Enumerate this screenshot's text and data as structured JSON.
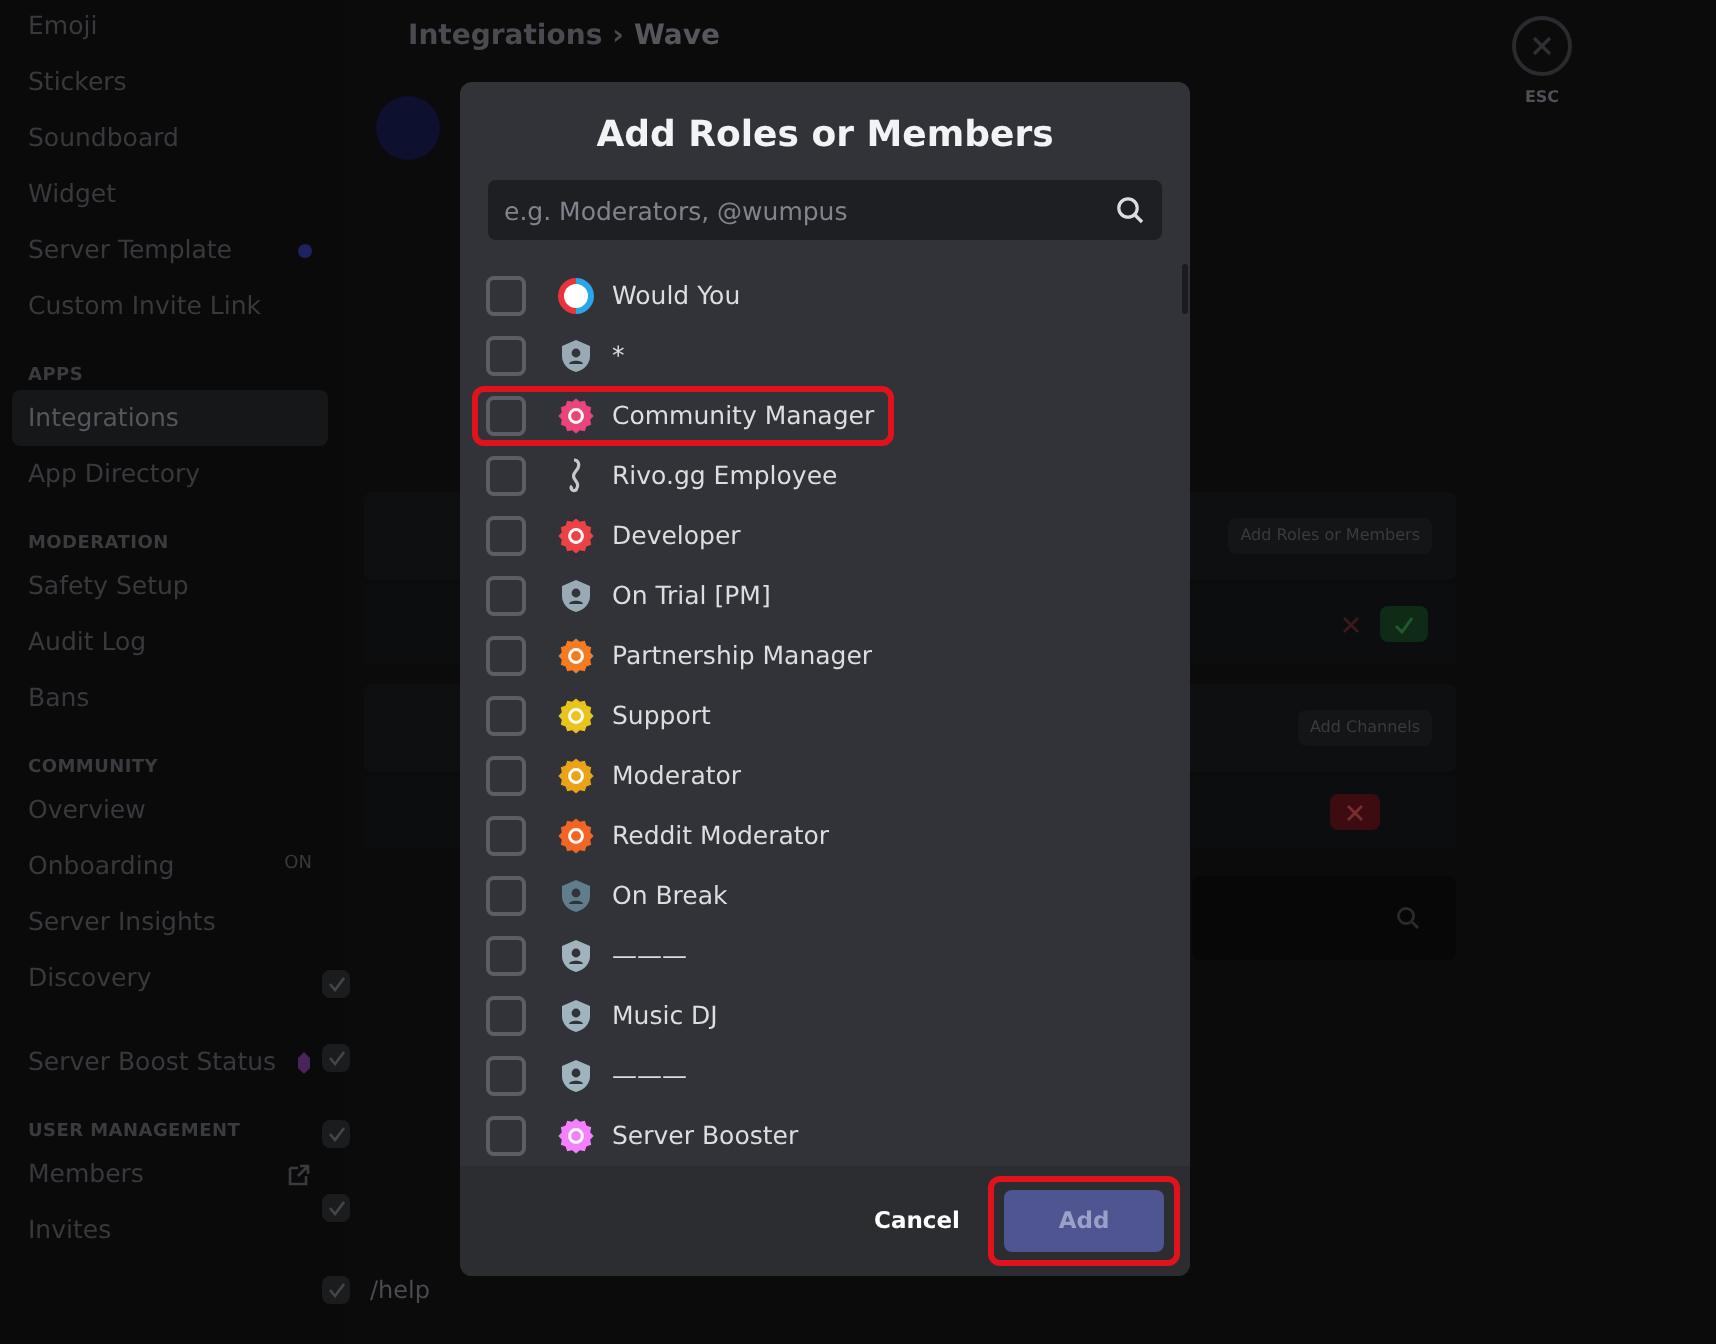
{
  "sidebar": {
    "items": [
      {
        "kind": "item",
        "label": "Emoji",
        "selected": false
      },
      {
        "kind": "item",
        "label": "Stickers",
        "selected": false
      },
      {
        "kind": "item",
        "label": "Soundboard",
        "selected": false
      },
      {
        "kind": "item",
        "label": "Widget",
        "selected": false
      },
      {
        "kind": "item_dot",
        "label": "Server Template",
        "selected": false
      },
      {
        "kind": "item",
        "label": "Custom Invite Link",
        "selected": false
      },
      {
        "kind": "header",
        "label": "APPS"
      },
      {
        "kind": "item",
        "label": "Integrations",
        "selected": true
      },
      {
        "kind": "item",
        "label": "App Directory",
        "selected": false
      },
      {
        "kind": "header",
        "label": "MODERATION"
      },
      {
        "kind": "item",
        "label": "Safety Setup",
        "selected": false
      },
      {
        "kind": "item",
        "label": "Audit Log",
        "selected": false
      },
      {
        "kind": "item",
        "label": "Bans",
        "selected": false
      },
      {
        "kind": "header",
        "label": "COMMUNITY"
      },
      {
        "kind": "item",
        "label": "Overview",
        "selected": false
      },
      {
        "kind": "item",
        "label": "Onboarding",
        "selected": false,
        "badge_text": "ON"
      },
      {
        "kind": "item",
        "label": "Server Insights",
        "selected": false
      },
      {
        "kind": "item",
        "label": "Discovery",
        "selected": false
      },
      {
        "kind": "item_boost",
        "label": "Server Boost Status",
        "selected": false
      },
      {
        "kind": "header",
        "label": "USER MANAGEMENT"
      },
      {
        "kind": "item_link",
        "label": "Members",
        "selected": false
      },
      {
        "kind": "item",
        "label": "Invites",
        "selected": false
      }
    ]
  },
  "page": {
    "breadcrumb": [
      "Integrations",
      "›",
      "Wave"
    ],
    "close_label": "ESC",
    "roles_card": {
      "button": "Add Roles or Members"
    },
    "channels_card": {
      "button": "Add Channels"
    },
    "command_rows": [
      {
        "checked": true
      },
      {
        "checked": true
      },
      {
        "checked": true
      },
      {
        "checked": true
      },
      {
        "checked": true,
        "label": "/help"
      }
    ]
  },
  "modal": {
    "title": "Add Roles or Members",
    "search": {
      "placeholder": "e.g. Moderators, @wumpus"
    },
    "items": [
      {
        "label": "Would You",
        "kind": "ring",
        "color": "#e8343b",
        "checked": false,
        "highlighted": false
      },
      {
        "label": "*",
        "kind": "shield",
        "color": "#99aab5",
        "checked": false,
        "highlighted": false
      },
      {
        "label": "Community Manager",
        "kind": "badge",
        "color": "#e9457a",
        "checked": false,
        "highlighted": true
      },
      {
        "label": "Rivo.gg Employee",
        "kind": "figure",
        "color": "#c8c8c8",
        "checked": false,
        "highlighted": false
      },
      {
        "label": "Developer",
        "kind": "badge",
        "color": "#ed4245",
        "checked": false,
        "highlighted": false
      },
      {
        "label": "On Trial [PM]",
        "kind": "shield",
        "color": "#99aab5",
        "checked": false,
        "highlighted": false
      },
      {
        "label": "Partnership Manager",
        "kind": "badge",
        "color": "#f47b20",
        "checked": false,
        "highlighted": false
      },
      {
        "label": "Support",
        "kind": "badge",
        "color": "#e9c41c",
        "checked": false,
        "highlighted": false
      },
      {
        "label": "Moderator",
        "kind": "badge",
        "color": "#e8a317",
        "checked": false,
        "highlighted": false
      },
      {
        "label": "Reddit Moderator",
        "kind": "badge",
        "color": "#f26522",
        "checked": false,
        "highlighted": false
      },
      {
        "label": "On Break",
        "kind": "shield",
        "color": "#607d8b",
        "checked": false,
        "highlighted": false
      },
      {
        "label": "———",
        "kind": "shield",
        "color": "#a0b4bd",
        "checked": false,
        "highlighted": false
      },
      {
        "label": "Music DJ",
        "kind": "shield",
        "color": "#a0b4bd",
        "checked": false,
        "highlighted": false
      },
      {
        "label": "———",
        "kind": "shield",
        "color": "#a0b4bd",
        "checked": false,
        "highlighted": false
      },
      {
        "label": "Server Booster",
        "kind": "badge",
        "color": "#f47fff",
        "checked": false,
        "highlighted": false
      }
    ],
    "cancel": "Cancel",
    "add": {
      "label": "Add",
      "disabled": true,
      "highlighted": true
    }
  }
}
